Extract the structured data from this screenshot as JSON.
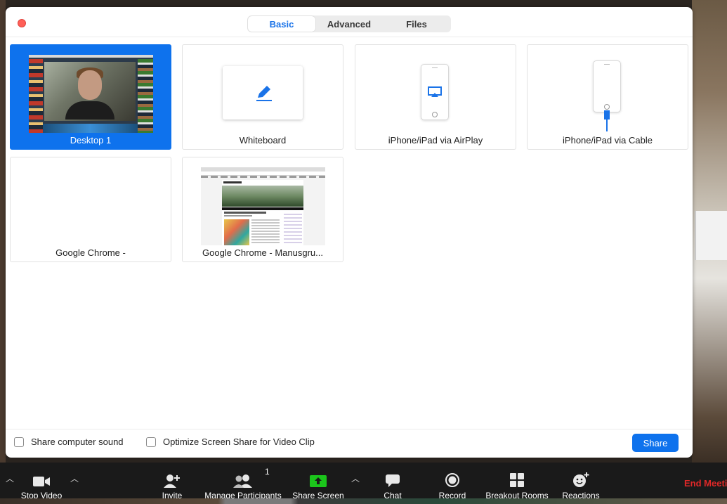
{
  "dialog": {
    "tabs": [
      {
        "label": "Basic",
        "active": true
      },
      {
        "label": "Advanced",
        "active": false
      },
      {
        "label": "Files",
        "active": false
      }
    ],
    "tiles": [
      {
        "label": "Desktop 1",
        "selected": true,
        "icon": "desktop-thumbnail"
      },
      {
        "label": "Whiteboard",
        "selected": false,
        "icon": "pencil-icon"
      },
      {
        "label": "iPhone/iPad via AirPlay",
        "selected": false,
        "icon": "airplay-icon"
      },
      {
        "label": "iPhone/iPad via Cable",
        "selected": false,
        "icon": "cable-icon"
      },
      {
        "label": "Google Chrome -",
        "selected": false,
        "icon": "blank-window"
      },
      {
        "label": "Google Chrome - Manusgru...",
        "selected": false,
        "icon": "browser-thumbnail"
      }
    ],
    "options": {
      "share_sound_label": "Share computer sound",
      "share_sound_checked": false,
      "optimize_label": "Optimize Screen Share for Video Clip",
      "optimize_checked": false
    },
    "share_button": "Share"
  },
  "toolbar": {
    "stop_video": "Stop Video",
    "invite": "Invite",
    "manage_participants": "Manage Participants",
    "participant_count": "1",
    "share_screen": "Share Screen",
    "chat": "Chat",
    "record": "Record",
    "breakout_rooms": "Breakout Rooms",
    "reactions": "Reactions",
    "end_meeting": "End Meeting"
  },
  "colors": {
    "accent": "#0e72ed",
    "share_screen_green": "#1bc51b",
    "end_red": "#e02828",
    "close_red": "#ff5f57"
  }
}
